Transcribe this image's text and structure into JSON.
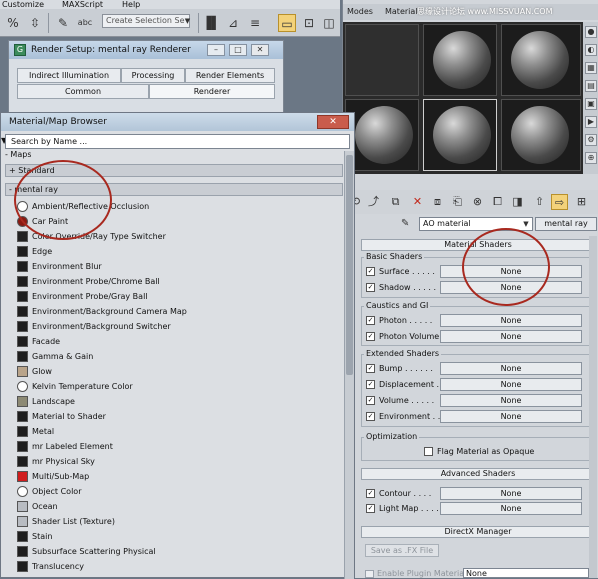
{
  "main_menu": {
    "items": [
      "Customize",
      "MAXScript",
      "Help"
    ]
  },
  "main_toolbar": {
    "selection_set_placeholder": "Create Selection Se",
    "icons": [
      "percent-icon",
      "spinner-snap-icon",
      "edit-named-selections-icon",
      "abc-icon",
      "mirror-icon",
      "align-icon",
      "layer-icon",
      "graphite-icon",
      "curve-editor-icon",
      "schematic-view-icon",
      "material-editor-icon",
      "render-setup-icon"
    ]
  },
  "render_setup": {
    "title": "Render Setup: mental ray Renderer",
    "tabs_row1": [
      "Indirect Illumination",
      "Processing",
      "Render Elements"
    ],
    "tabs_row2": [
      "Common",
      "Renderer"
    ]
  },
  "material_editor": {
    "menu": [
      "Modes",
      "Material"
    ],
    "watermark": "思缘设计论坛 www.MISSVUAN.COM",
    "material_name": "AO material",
    "material_type": "mental ray",
    "rollout_title": "Material Shaders",
    "groups": [
      {
        "title": "Basic Shaders",
        "rows": [
          {
            "label": "Surface . . . . .",
            "value": "None",
            "checked": true
          },
          {
            "label": "Shadow . . . . .",
            "value": "None",
            "checked": true
          }
        ]
      },
      {
        "title": "Caustics and GI",
        "rows": [
          {
            "label": "Photon . . . . .",
            "value": "None",
            "checked": true
          },
          {
            "label": "Photon Volume . .",
            "value": "None",
            "checked": true
          }
        ]
      },
      {
        "title": "Extended Shaders",
        "rows": [
          {
            "label": "Bump . . . . . .",
            "value": "None",
            "checked": true
          },
          {
            "label": "Displacement . . .",
            "value": "None",
            "checked": true
          },
          {
            "label": "Volume . . . . .",
            "value": "None",
            "checked": true
          },
          {
            "label": "Environment . .",
            "value": "None",
            "checked": true
          }
        ]
      },
      {
        "title": "Optimization",
        "rows": [
          {
            "label": "Flag Material as Opaque",
            "checked": false
          }
        ]
      }
    ],
    "advanced_title": "Advanced Shaders",
    "advanced_rows": [
      {
        "label": "Contour . . . .",
        "value": "None",
        "checked": true
      },
      {
        "label": "Light Map . . . .",
        "value": "None",
        "checked": true
      }
    ],
    "directx_title": "DirectX Manager",
    "save_fx_label": "Save as .FX File",
    "enable_plugin_label": "Enable Plugin Material",
    "plugin_select_value": "None"
  },
  "map_browser": {
    "title": "Material/Map Browser",
    "search_placeholder": "Search by Name ...",
    "maps_label": "- Maps",
    "standard_label": "+ Standard",
    "mental_ray_label": "- mental ray",
    "items": [
      {
        "label": "Ambient/Reflective Occlusion",
        "swatch": "#ffffff",
        "round": true
      },
      {
        "label": "Car Paint",
        "swatch": "#8a1a12",
        "round": true
      },
      {
        "label": "Color Override/Ray Type Switcher",
        "swatch": "#222222",
        "round": false
      },
      {
        "label": "Edge",
        "swatch": "#1e1e1e",
        "round": false
      },
      {
        "label": "Environment Blur",
        "swatch": "#1e1e1e",
        "round": false
      },
      {
        "label": "Environment Probe/Chrome Ball",
        "swatch": "#1e1e1e",
        "round": false
      },
      {
        "label": "Environment Probe/Gray Ball",
        "swatch": "#1e1e1e",
        "round": false
      },
      {
        "label": "Environment/Background Camera Map",
        "swatch": "#1e1e1e",
        "round": false
      },
      {
        "label": "Environment/Background Switcher",
        "swatch": "#1e1e1e",
        "round": false
      },
      {
        "label": "Facade",
        "swatch": "#1e1e1e",
        "round": false
      },
      {
        "label": "Gamma & Gain",
        "swatch": "#1e1e1e",
        "round": false
      },
      {
        "label": "Glow",
        "swatch": "#b9a48a",
        "round": false
      },
      {
        "label": "Kelvin Temperature Color",
        "swatch": "#ffffff",
        "round": true
      },
      {
        "label": "Landscape",
        "swatch": "#8d8a74",
        "round": false
      },
      {
        "label": "Material to Shader",
        "swatch": "#1e1e1e",
        "round": false
      },
      {
        "label": "Metal",
        "swatch": "#1e1e1e",
        "round": false
      },
      {
        "label": "mr Labeled Element",
        "swatch": "#1e1e1e",
        "round": false
      },
      {
        "label": "mr Physical Sky",
        "swatch": "#1e1e1e",
        "round": false
      },
      {
        "label": "Multi/Sub-Map",
        "swatch": "#d01d1d",
        "round": false
      },
      {
        "label": "Object Color",
        "swatch": "#ffffff",
        "round": true
      },
      {
        "label": "Ocean",
        "swatch": "#b8bcc2",
        "round": false
      },
      {
        "label": "Shader List (Texture)",
        "swatch": "#b8bcc2",
        "round": false
      },
      {
        "label": "Stain",
        "swatch": "#1e1e1e",
        "round": false
      },
      {
        "label": "Subsurface Scattering Physical",
        "swatch": "#1e1e1e",
        "round": false
      },
      {
        "label": "Translucency",
        "swatch": "#1e1e1e",
        "round": false
      }
    ]
  },
  "colors": {
    "annotation": "#a8291f",
    "highlight": "#f3d27a"
  }
}
